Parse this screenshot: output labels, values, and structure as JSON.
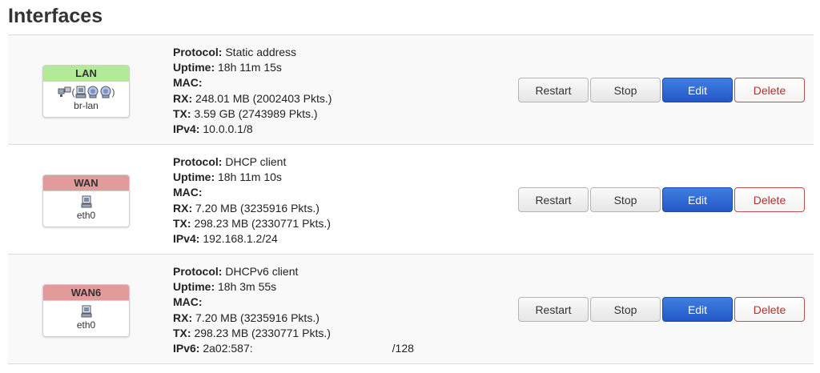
{
  "page": {
    "title": "Interfaces"
  },
  "labels": {
    "protocol": "Protocol:",
    "uptime": "Uptime:",
    "mac": "MAC:",
    "rx": "RX:",
    "tx": "TX:",
    "ipv4": "IPv4:",
    "ipv6": "IPv6:"
  },
  "buttons": {
    "restart": "Restart",
    "stop": "Stop",
    "edit": "Edit",
    "delete": "Delete"
  },
  "interfaces": [
    {
      "name": "LAN",
      "device": "br-lan",
      "bridge_open": "(",
      "bridge_close": ")",
      "protocol": "Static address",
      "uptime": "18h 11m 15s",
      "mac": "",
      "rx": "248.01 MB (2002403 Pkts.)",
      "tx": "3.59 GB (2743989 Pkts.)",
      "addr": "10.0.0.1/8"
    },
    {
      "name": "WAN",
      "device": "eth0",
      "protocol": "DHCP client",
      "uptime": "18h 11m 10s",
      "mac": "",
      "rx": "7.20 MB (3235916 Pkts.)",
      "tx": "298.23 MB (2330771 Pkts.)",
      "addr": "192.168.1.2/24"
    },
    {
      "name": "WAN6",
      "device": "eth0",
      "protocol": "DHCPv6 client",
      "uptime": "18h 3m 55s",
      "mac": "",
      "rx": "7.20 MB (3235916 Pkts.)",
      "tx": "298.23 MB (2330771 Pkts.)",
      "addr_prefix": "2a02:587:",
      "addr_suffix": "/128"
    }
  ],
  "colors": {
    "lan_header": "#b3ea9a",
    "wan_header": "#e29a9a",
    "edit_button": "#2457c8",
    "delete_text": "#b03030"
  },
  "icons": {
    "bridge": "network-bridge-icon",
    "ethernet": "ethernet-port-icon",
    "wireless": "wireless-icon"
  }
}
